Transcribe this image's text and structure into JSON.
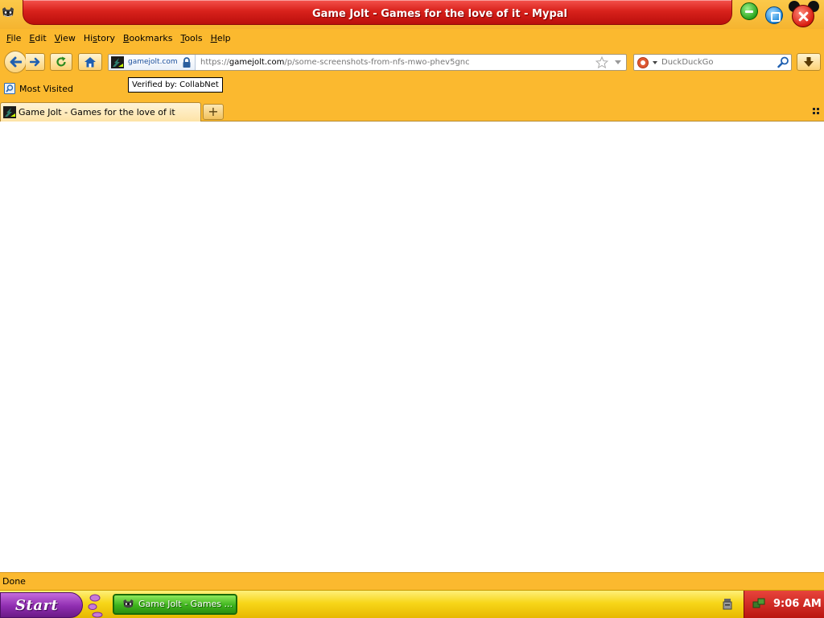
{
  "window": {
    "title": "Game Jolt - Games for the love of it - Mypal",
    "app_icon": "raccoon-icon",
    "controls": [
      "minimize-icon",
      "maximize-icon",
      "close-icon"
    ]
  },
  "menubar": {
    "items": [
      "File",
      "Edit",
      "View",
      "History",
      "Bookmarks",
      "Tools",
      "Help"
    ],
    "underline_keys": [
      "F",
      "E",
      "V",
      "s",
      "B",
      "T",
      "H"
    ]
  },
  "navbar": {
    "buttons": [
      "back-icon",
      "forward-icon",
      "reload-icon",
      "home-icon"
    ],
    "identity_label": "gamejolt.com",
    "url_scheme": "https://",
    "url_domain": "gamejolt.com",
    "url_path": "/p/some-screenshots-from-nfs-mwo-phev5gnc",
    "search_placeholder": "DuckDuckGo",
    "search_engine_icon": "duckduckgo-icon"
  },
  "tooltip": {
    "text": "Verified by: CollabNet"
  },
  "bookmarks": {
    "most_visited": "Most Visited"
  },
  "tabs": [
    {
      "label": "Game Jolt - Games for the love of it",
      "active": true
    }
  ],
  "newtab_label": "+",
  "status": {
    "text": "Done"
  },
  "taskbar": {
    "start_label": "Start",
    "task_label": "Game Jolt - Games ...",
    "clock": "9:06 AM"
  },
  "colors": {
    "chrome": "#fbb92f",
    "title_red": "#d9221c",
    "start_purple": "#8f2db0",
    "task_green": "#3fb41e",
    "taskbar_yellow": "#f7d619"
  }
}
